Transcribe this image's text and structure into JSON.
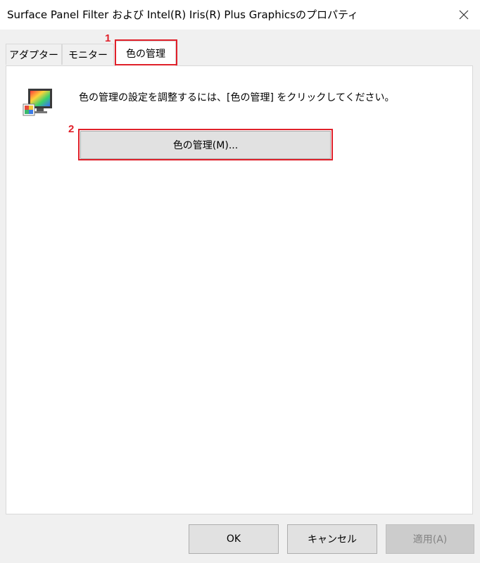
{
  "window": {
    "title": "Surface Panel Filter および Intel(R) Iris(R) Plus Graphicsのプロパティ",
    "close_icon": "close-icon"
  },
  "tabs": [
    {
      "label": "アダプター"
    },
    {
      "label": "モニター"
    },
    {
      "label": "色の管理",
      "active": true
    }
  ],
  "annotations": {
    "marker_1": "1",
    "marker_2": "2",
    "highlight_color": "#e0202a"
  },
  "panel": {
    "icon": "monitor-color-icon",
    "description": "色の管理の設定を調整するには、[色の管理] をクリックしてください。",
    "color_management_button": "色の管理(M)..."
  },
  "footer": {
    "ok": "OK",
    "cancel": "キャンセル",
    "apply": "適用(A)"
  }
}
